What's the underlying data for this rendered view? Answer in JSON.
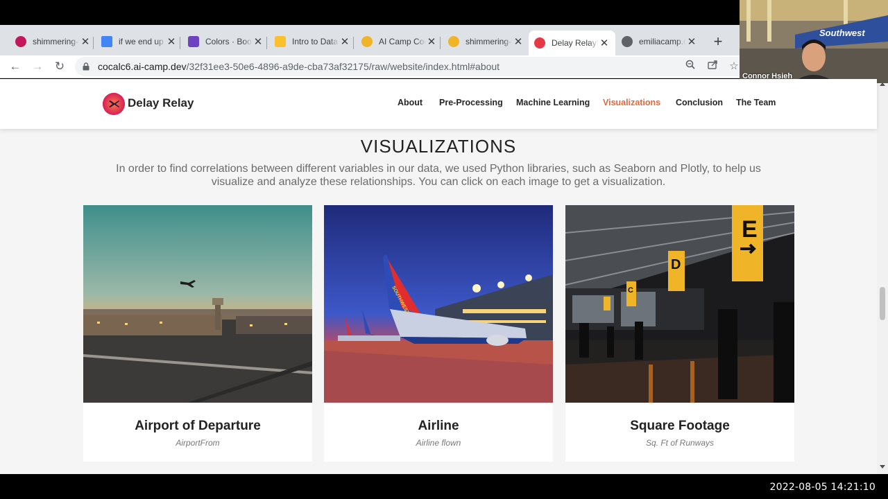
{
  "browser": {
    "tabs": [
      {
        "title": "shimmering-",
        "favicon_color": "#c2185b"
      },
      {
        "title": "if we end up",
        "favicon_color": "#4285f4"
      },
      {
        "title": "Colors · Boot",
        "favicon_color": "#6f42c1"
      },
      {
        "title": "Intro to Data",
        "favicon_color": "#fbc02d"
      },
      {
        "title": "AI Camp Coc",
        "favicon_color": "#f0b429"
      },
      {
        "title": "shimmering-",
        "favicon_color": "#f0b429"
      },
      {
        "title": "Delay Relay!",
        "favicon_color": "#e63946",
        "active": true
      },
      {
        "title": "emiliacamp.c",
        "favicon_color": "#5f6368"
      }
    ],
    "url_host": "cocalc6.ai-camp.dev",
    "url_path": "/32f31ee3-50e6-4896-a9de-cba73af32175/raw/website/index.html#about",
    "icons": [
      "back-icon",
      "forward-icon",
      "reload-icon",
      "lock-icon",
      "zoom-icon",
      "share-icon",
      "star-icon",
      "close-icon",
      "new-tab-icon"
    ]
  },
  "site": {
    "brand": "Delay Relay",
    "nav": [
      {
        "label": "About",
        "active": false
      },
      {
        "label": "Pre-Processing",
        "active": false
      },
      {
        "label": "Machine Learning",
        "active": false
      },
      {
        "label": "Visualizations",
        "active": true
      },
      {
        "label": "Conclusion",
        "active": false
      },
      {
        "label": "The Team",
        "active": false
      }
    ],
    "accent_color": "#e2683c",
    "section_title": "VISUALIZATIONS",
    "section_subtitle": "In order to find correlations between different variables in our data, we used Python libraries, such as Seaborn and Plotly, to help us visualize and analyze these relationships. You can click on each image to get a visualization.",
    "cards": [
      {
        "title": "Airport of Departure",
        "subtitle": "AirportFrom"
      },
      {
        "title": "Airline",
        "subtitle": "Airline flown",
        "plane_brand": "SOUTHWEST"
      },
      {
        "title": "Square Footage",
        "subtitle": "Sq. Ft of Runways",
        "gates": [
          "E",
          "D",
          "C"
        ]
      }
    ]
  },
  "video": {
    "participant_name": "Connor Hsieh",
    "background_brand": "Southwest"
  },
  "timestamp": "2022-08-05  14:21:10"
}
